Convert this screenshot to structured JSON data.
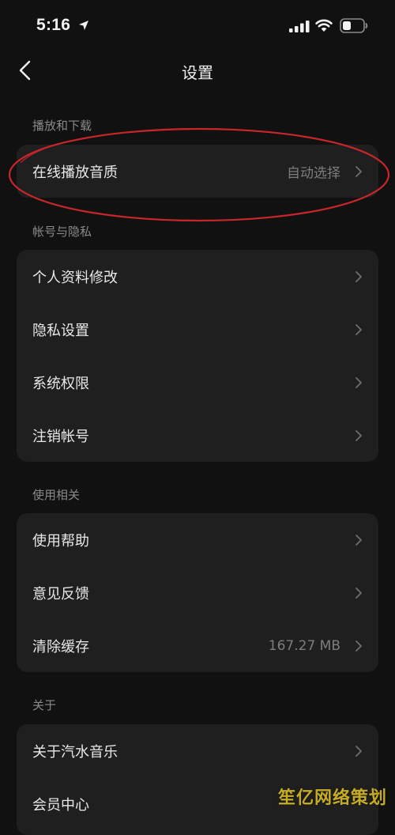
{
  "status_bar": {
    "time": "5:16"
  },
  "header": {
    "title": "设置"
  },
  "sections": [
    {
      "header": "播放和下载",
      "rows": [
        {
          "label": "在线播放音质",
          "value": "自动选择"
        }
      ]
    },
    {
      "header": "帐号与隐私",
      "rows": [
        {
          "label": "个人资料修改"
        },
        {
          "label": "隐私设置"
        },
        {
          "label": "系统权限"
        },
        {
          "label": "注销帐号"
        }
      ]
    },
    {
      "header": "使用相关",
      "rows": [
        {
          "label": "使用帮助"
        },
        {
          "label": "意见反馈"
        },
        {
          "label": "清除缓存",
          "value": "167.27 MB"
        }
      ]
    },
    {
      "header": "关于",
      "rows": [
        {
          "label": "关于汽水音乐"
        },
        {
          "label": "会员中心"
        }
      ]
    }
  ],
  "watermark": "笙亿网络策划",
  "colors": {
    "background": "#111111",
    "card": "#1f1f1f",
    "annotation": "#c8262a"
  }
}
